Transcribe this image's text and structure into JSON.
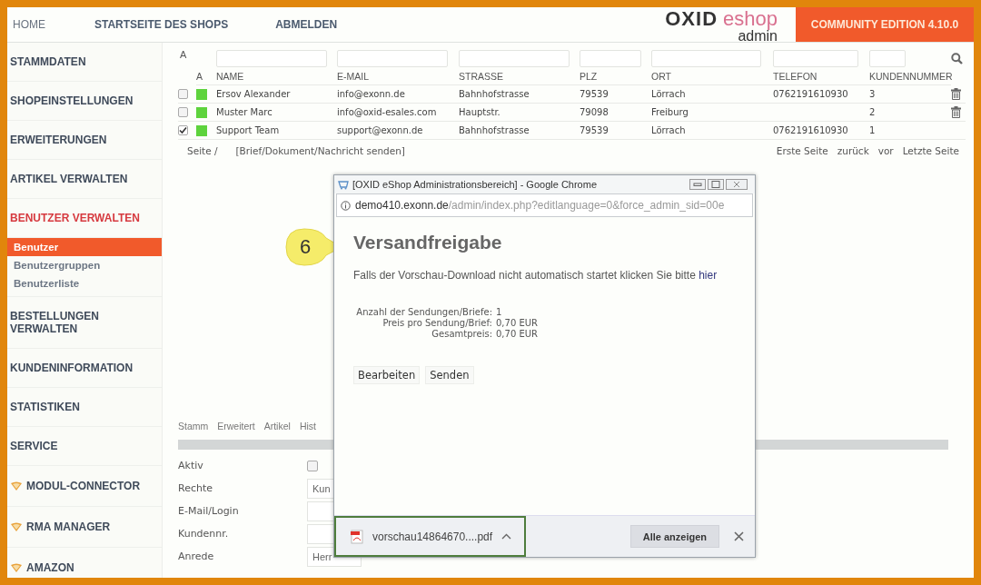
{
  "top_nav": {
    "links": [
      "HOME",
      "STARTSEITE DES SHOPS",
      "ABMELDEN"
    ],
    "logo": {
      "brand": "OXID",
      "product": "eshop",
      "sub": "admin"
    },
    "edition": "COMMUNITY EDITION 4.10.0"
  },
  "sidebar": {
    "items": [
      {
        "label": "STAMMDATEN",
        "kind": "section",
        "selected": false
      },
      {
        "label": "SHOPEINSTELLUNGEN",
        "kind": "section",
        "selected": false
      },
      {
        "label": "ERWEITERUNGEN",
        "kind": "section",
        "selected": false
      },
      {
        "label": "ARTIKEL VERWALTEN",
        "kind": "section",
        "selected": false
      },
      {
        "label": "BENUTZER VERWALTEN",
        "kind": "section",
        "selected": true,
        "children": [
          {
            "label": "Benutzer",
            "selected": true
          },
          {
            "label": "Benutzergruppen",
            "selected": false
          },
          {
            "label": "Benutzerliste",
            "selected": false
          }
        ]
      },
      {
        "label": "BESTELLUNGEN VERWALTEN",
        "kind": "section",
        "selected": false
      },
      {
        "label": "KUNDENINFORMATION",
        "kind": "section",
        "selected": false
      },
      {
        "label": "STATISTIKEN",
        "kind": "section",
        "selected": false
      },
      {
        "label": "SERVICE",
        "kind": "section",
        "selected": false
      },
      {
        "label": "MODUL-CONNECTOR",
        "kind": "module",
        "selected": false
      },
      {
        "label": "RMA MANAGER",
        "kind": "module",
        "selected": false
      },
      {
        "label": "AMAZON",
        "kind": "module",
        "selected": false
      }
    ]
  },
  "user_list": {
    "filter_label": "A",
    "active_header": "A",
    "columns": [
      "NAME",
      "E-MAIL",
      "STRASSE",
      "PLZ",
      "ORT",
      "TELEFON",
      "KUNDENNUMMER"
    ],
    "rows": [
      {
        "checked": false,
        "active": true,
        "cells": [
          "Ersov Alexander",
          "info@exonn.de",
          "Bahnhofstrasse",
          "79539",
          "Lörrach",
          "0762191610930",
          "3"
        ],
        "deletable": true
      },
      {
        "checked": false,
        "active": true,
        "cells": [
          "Muster Marc",
          "info@oxid-esales.com",
          "Hauptstr.",
          "79098",
          "Freiburg",
          "",
          "2"
        ],
        "deletable": true
      },
      {
        "checked": true,
        "active": true,
        "cells": [
          "Support Team",
          "support@exonn.de",
          "Bahnhofstrasse",
          "79539",
          "Lörrach",
          "0762191610930",
          "1"
        ],
        "deletable": false
      }
    ],
    "pager": {
      "page_label": "Seite /",
      "action": "[Brief/Dokument/Nachricht senden]",
      "nav": [
        "Erste Seite",
        "zurück",
        "vor",
        "Letzte Seite"
      ]
    }
  },
  "detail": {
    "tabs": [
      "Stamm",
      "Erweitert",
      "Artikel",
      "Hist"
    ],
    "fields": [
      {
        "label": "Aktiv",
        "kind": "checkbox",
        "checked": false
      },
      {
        "label": "Rechte",
        "kind": "select",
        "value": "Kun"
      },
      {
        "label": "E-Mail/Login",
        "kind": "text"
      },
      {
        "label": "Kundennr.",
        "kind": "text"
      },
      {
        "label": "Anrede",
        "kind": "select",
        "value": "Herr"
      }
    ]
  },
  "callout": {
    "number": "6"
  },
  "popup": {
    "title": "[OXID eShop Administrationsbereich] - Google Chrome",
    "url_host": "demo410.exonn.de",
    "url_path": "/admin/index.php?editlanguage=0&force_admin_sid=00e",
    "heading": "Versandfreigabe",
    "message": "Falls der Vorschau-Download nicht automatisch startet klicken Sie bitte",
    "link": "hier",
    "summary": [
      {
        "label": "Anzahl der Sendungen/Briefe:",
        "value": "1"
      },
      {
        "label": "Preis pro Sendung/Brief:",
        "value": "0,70 EUR"
      },
      {
        "label": "Gesamtpreis:",
        "value": "0,70 EUR"
      }
    ],
    "buttons": [
      "Bearbeiten",
      "Senden"
    ],
    "download": {
      "file": "vorschau14864670....pdf",
      "show_all": "Alle anzeigen"
    }
  }
}
